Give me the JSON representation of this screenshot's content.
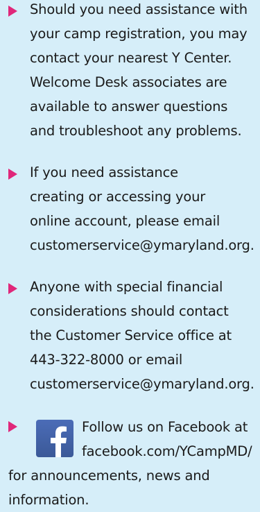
{
  "items": [
    {
      "text": "Should you need assistance with\nyour camp registration, you may\ncontact your nearest Y Center.\nWelcome Desk associates are\navailable to answer questions\nand troubleshoot any problems."
    },
    {
      "text": "If you need assistance\ncreating or accessing your\nonline account, please email\ncustomerservice@ymaryland.org."
    },
    {
      "text": "Anyone with special financial\nconsiderations should contact\nthe Customer Service office at\n443-322-8000 or email\ncustomerservice@ymaryland.org."
    }
  ],
  "facebook": {
    "icon": "facebook-icon",
    "line1": "Follow us on Facebook at\nfacebook.com/YCampMD/",
    "line2": "for announcements, news and\ninformation."
  },
  "colors": {
    "background": "#d6eef9",
    "bullet": "#e0277a",
    "facebook": "#3b5998"
  }
}
